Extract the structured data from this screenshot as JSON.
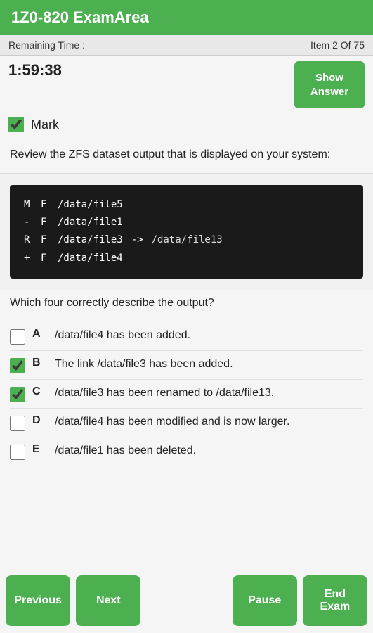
{
  "header": {
    "title": "1Z0-820 ExamArea"
  },
  "topbar": {
    "remaining_label": "Remaining Time :",
    "item_label": "Item 2 Of 75"
  },
  "timer": {
    "value": "1:59:38"
  },
  "show_answer": {
    "label": "Show Answer"
  },
  "mark": {
    "label": "Mark",
    "checked": true
  },
  "question": {
    "text": "Review the ZFS dataset output that is displayed on your system:",
    "which_text": "Which four correctly describe the output?"
  },
  "dataset": {
    "rows": [
      {
        "col1": "M",
        "col2": "F",
        "col3": "/data/file5",
        "arrow": "",
        "dest": ""
      },
      {
        "col1": "-",
        "col2": "F",
        "col3": "/data/file1",
        "arrow": "",
        "dest": ""
      },
      {
        "col1": "R",
        "col2": "F",
        "col3": "/data/file3",
        "arrow": "->",
        "dest": "/data/file13"
      },
      {
        "col1": "+",
        "col2": "F",
        "col3": "/data/file4",
        "arrow": "",
        "dest": ""
      }
    ]
  },
  "options": [
    {
      "letter": "A",
      "text": "/data/file4 has been added.",
      "checked": false
    },
    {
      "letter": "B",
      "text": "The link /data/file3 has been added.",
      "checked": true
    },
    {
      "letter": "C",
      "text": "/data/file3 has been renamed to /data/file13.",
      "checked": true
    },
    {
      "letter": "D",
      "text": "/data/file4 has been modified and is now larger.",
      "checked": false
    },
    {
      "letter": "E",
      "text": "/data/file1 has been deleted.",
      "checked": false
    }
  ],
  "nav": {
    "previous": "Previous",
    "next": "Next",
    "pause": "Pause",
    "end_exam": "End Exam"
  }
}
